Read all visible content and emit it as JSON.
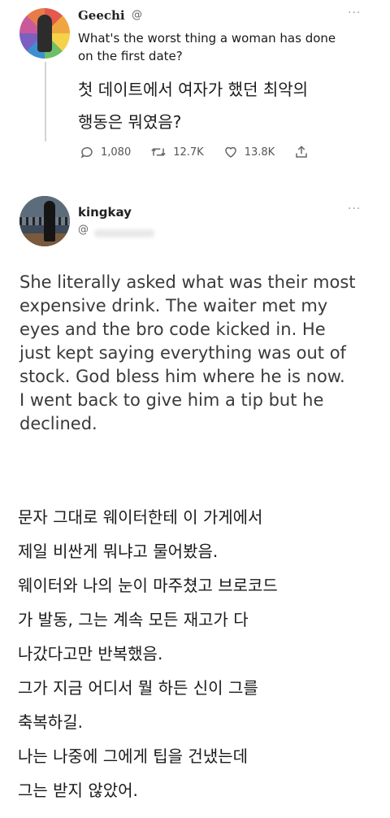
{
  "tweet1": {
    "name": "Geechi",
    "handle": "@",
    "more": "···",
    "text_en": [
      "What's the worst thing a woman has done",
      "on the first date?"
    ],
    "text_ko": [
      "첫 데이트에서 여자가 했던 최악의",
      "행동은 뭐였음?"
    ],
    "stats": {
      "replies": "1,080",
      "retweets": "12.7K",
      "likes": "13.8K"
    }
  },
  "tweet2": {
    "name": "kingkay",
    "handle": "@",
    "more": "···",
    "text_en": [
      "She literally asked what was their most",
      "expensive drink. The waiter met my",
      "eyes and the bro code kicked in. He",
      "just kept saying everything was out of",
      "stock. God bless him where he is now.",
      "I went back to give him a tip but he",
      "declined."
    ],
    "text_ko": [
      "문자 그대로 웨이터한테 이 가게에서",
      "제일 비싼게 뭐냐고 물어봤음.",
      "웨이터와 나의 눈이 마주쳤고 브로코드",
      "가 발동, 그는 계속 모든 재고가 다",
      "나갔다고만 반복했음.",
      "그가 지금 어디서 뭘 하든 신이 그를",
      "축복하길.",
      "나는 나중에 그에게 팁을 건냈는데",
      "그는 받지 않았어."
    ]
  }
}
